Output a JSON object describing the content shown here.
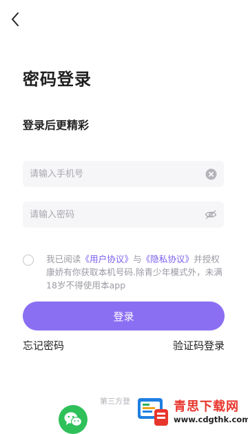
{
  "nav": {
    "back_icon": "chevron-left-icon"
  },
  "header": {
    "title": "密码登录",
    "subtitle": "登录后更精彩"
  },
  "form": {
    "phone": {
      "placeholder": "请输入手机号",
      "value": "",
      "clear_icon": "clear-circle-icon"
    },
    "password": {
      "placeholder": "请输入密码",
      "value": "",
      "visibility_icon": "eye-hidden-icon"
    }
  },
  "agreement": {
    "checked": false,
    "prefix": "我已阅读",
    "user_agreement": "《用户协议》",
    "and": "与",
    "privacy_policy": "《隐私协议》",
    "suffix": "并授权康娇有你获取本机号码.除青少年模式外，未满18岁不得使用本app"
  },
  "actions": {
    "login_label": "登录",
    "forgot_password": "忘记密码",
    "sms_login": "验证码登录"
  },
  "third_party": {
    "label": "第三方登",
    "wechat_icon": "wechat-icon"
  },
  "watermark": {
    "name": "青思下载网",
    "url": "www.cdgthk.com"
  },
  "colors": {
    "accent": "#8b6ff3",
    "link": "#7a5cf0",
    "wechat": "#2fc05a",
    "watermark_red": "#e8352c"
  }
}
